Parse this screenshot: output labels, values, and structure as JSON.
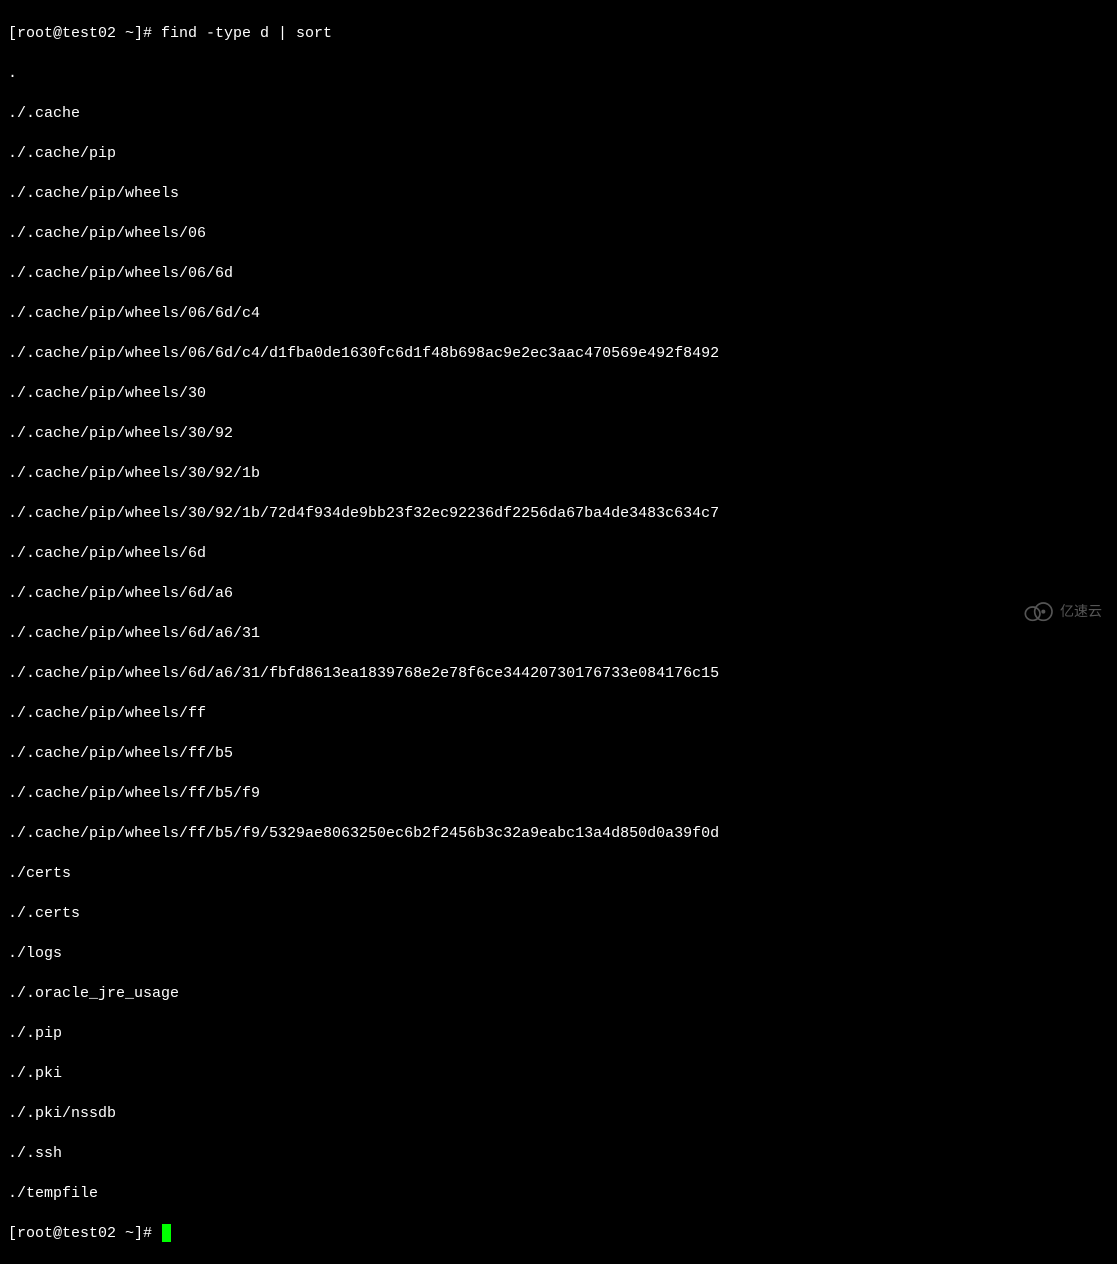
{
  "prompt1": {
    "user": "root",
    "host": "test02",
    "path": "~",
    "symbol": "#",
    "full": "[root@test02 ~]# "
  },
  "command1": "find -type d | sort",
  "output": [
    ".",
    "./.cache",
    "./.cache/pip",
    "./.cache/pip/wheels",
    "./.cache/pip/wheels/06",
    "./.cache/pip/wheels/06/6d",
    "./.cache/pip/wheels/06/6d/c4",
    "./.cache/pip/wheels/06/6d/c4/d1fba0de1630fc6d1f48b698ac9e2ec3aac470569e492f8492",
    "./.cache/pip/wheels/30",
    "./.cache/pip/wheels/30/92",
    "./.cache/pip/wheels/30/92/1b",
    "./.cache/pip/wheels/30/92/1b/72d4f934de9bb23f32ec92236df2256da67ba4de3483c634c7",
    "./.cache/pip/wheels/6d",
    "./.cache/pip/wheels/6d/a6",
    "./.cache/pip/wheels/6d/a6/31",
    "./.cache/pip/wheels/6d/a6/31/fbfd8613ea1839768e2e78f6ce34420730176733e084176c15",
    "./.cache/pip/wheels/ff",
    "./.cache/pip/wheels/ff/b5",
    "./.cache/pip/wheels/ff/b5/f9",
    "./.cache/pip/wheels/ff/b5/f9/5329ae8063250ec6b2f2456b3c32a9eabc13a4d850d0a39f0d",
    "./certs",
    "./.certs",
    "./logs",
    "./.oracle_jre_usage",
    "./.pip",
    "./.pki",
    "./.pki/nssdb",
    "./.ssh",
    "./tempfile"
  ],
  "prompt2": {
    "full": "[root@test02 ~]# "
  },
  "watermark": {
    "text": "亿速云"
  }
}
